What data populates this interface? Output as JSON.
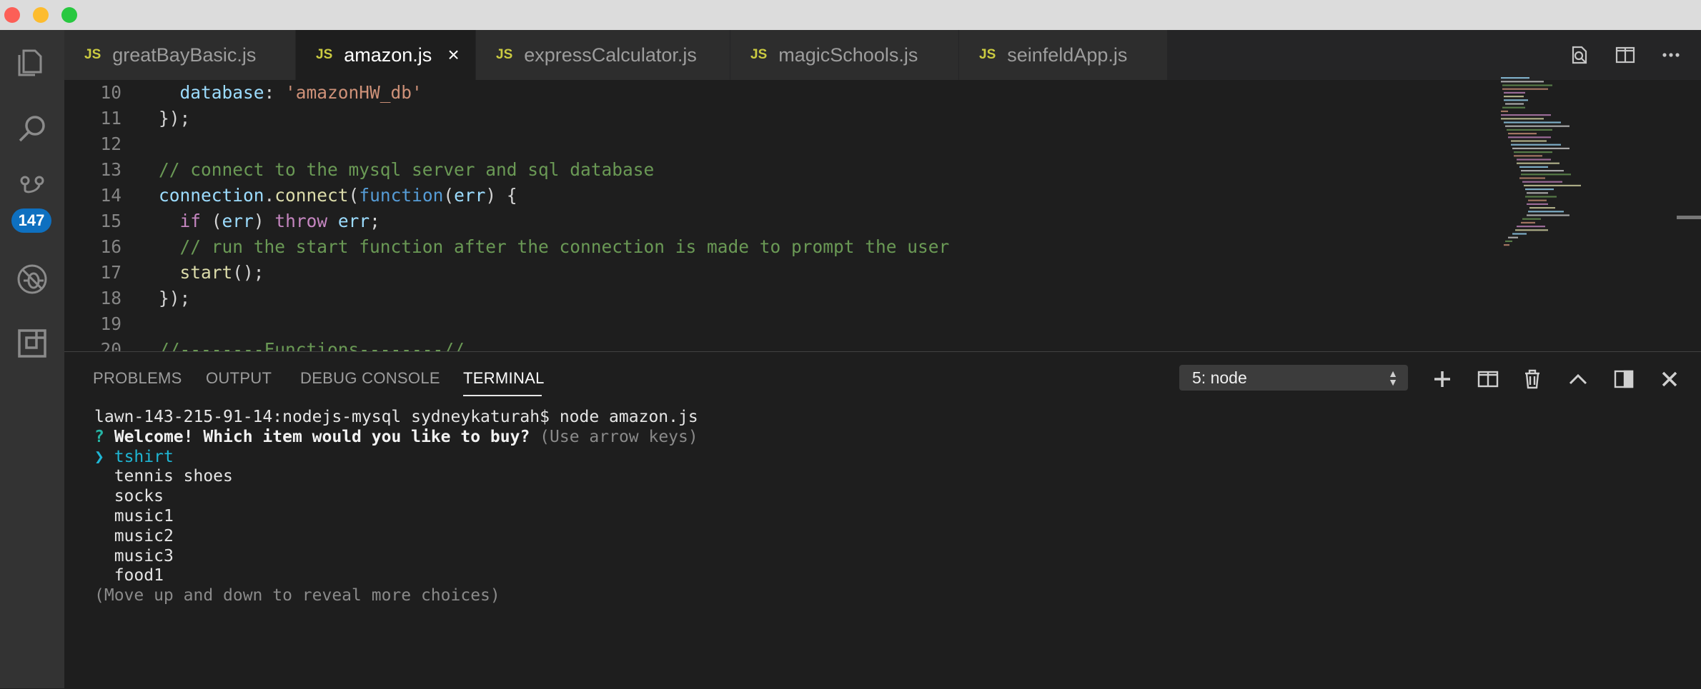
{
  "window": {
    "controls": [
      "close",
      "minimize",
      "maximize"
    ]
  },
  "activity_bar": {
    "items": [
      "explorer-icon",
      "search-icon",
      "source-control-icon",
      "debug-icon",
      "extensions-icon"
    ],
    "source_control_badge": "147"
  },
  "tabs": [
    {
      "icon": "JS",
      "label": "greatBayBasic.js",
      "active": false
    },
    {
      "icon": "JS",
      "label": "amazon.js",
      "active": true,
      "close": "×"
    },
    {
      "icon": "JS",
      "label": "expressCalculator.js",
      "active": false
    },
    {
      "icon": "JS",
      "label": "magicSchools.js",
      "active": false
    },
    {
      "icon": "JS",
      "label": "seinfeldApp.js",
      "active": false
    }
  ],
  "editor": {
    "lines": [
      {
        "n": "10",
        "parts": [
          [
            "  ",
            "plain"
          ],
          [
            "database",
            "prop"
          ],
          [
            ": ",
            "plain"
          ],
          [
            "'amazonHW_db'",
            "str"
          ]
        ]
      },
      {
        "n": "11",
        "parts": [
          [
            "});",
            "plain"
          ]
        ]
      },
      {
        "n": "12",
        "parts": []
      },
      {
        "n": "13",
        "parts": [
          [
            "// connect to the mysql server and sql database",
            "comment"
          ]
        ]
      },
      {
        "n": "14",
        "parts": [
          [
            "connection",
            "prop"
          ],
          [
            ".",
            "plain"
          ],
          [
            "connect",
            "fn"
          ],
          [
            "(",
            "plain"
          ],
          [
            "function",
            "kw"
          ],
          [
            "(",
            "plain"
          ],
          [
            "err",
            "prop"
          ],
          [
            ") {",
            "plain"
          ]
        ]
      },
      {
        "n": "15",
        "parts": [
          [
            "  ",
            "plain"
          ],
          [
            "if",
            "ctrl"
          ],
          [
            " (",
            "plain"
          ],
          [
            "err",
            "prop"
          ],
          [
            ") ",
            "plain"
          ],
          [
            "throw",
            "ctrl"
          ],
          [
            " ",
            "plain"
          ],
          [
            "err",
            "prop"
          ],
          [
            ";",
            "plain"
          ]
        ]
      },
      {
        "n": "16",
        "parts": [
          [
            "  // run the start function after the connection is made to prompt the user",
            "comment"
          ]
        ]
      },
      {
        "n": "17",
        "parts": [
          [
            "  ",
            "plain"
          ],
          [
            "start",
            "fn"
          ],
          [
            "();",
            "plain"
          ]
        ]
      },
      {
        "n": "18",
        "parts": [
          [
            "});",
            "plain"
          ]
        ]
      },
      {
        "n": "19",
        "parts": []
      },
      {
        "n": "20",
        "parts": [
          [
            "//--------Functions--------//",
            "comment"
          ]
        ]
      }
    ]
  },
  "panel": {
    "tabs": [
      "PROBLEMS",
      "OUTPUT",
      "DEBUG CONSOLE",
      "TERMINAL"
    ],
    "active_tab": "TERMINAL",
    "terminal_select": "5: node",
    "actions": [
      "plus-icon",
      "split-icon",
      "trash-icon",
      "chevron-up-icon",
      "maximize-panel-icon",
      "close-icon"
    ]
  },
  "terminal": {
    "command_line": "lawn-143-215-91-14:nodejs-mysql sydneykaturah$ node amazon.js",
    "prompt_mark": "?",
    "question": "Welcome! Which item would you like to buy?",
    "hint": "(Use arrow keys)",
    "pointer": "❯",
    "selected": "tshirt",
    "choices": [
      "tennis shoes",
      "socks",
      "music1",
      "music2",
      "music3",
      "food1"
    ],
    "footer": "(Move up and down to reveal more choices)"
  }
}
